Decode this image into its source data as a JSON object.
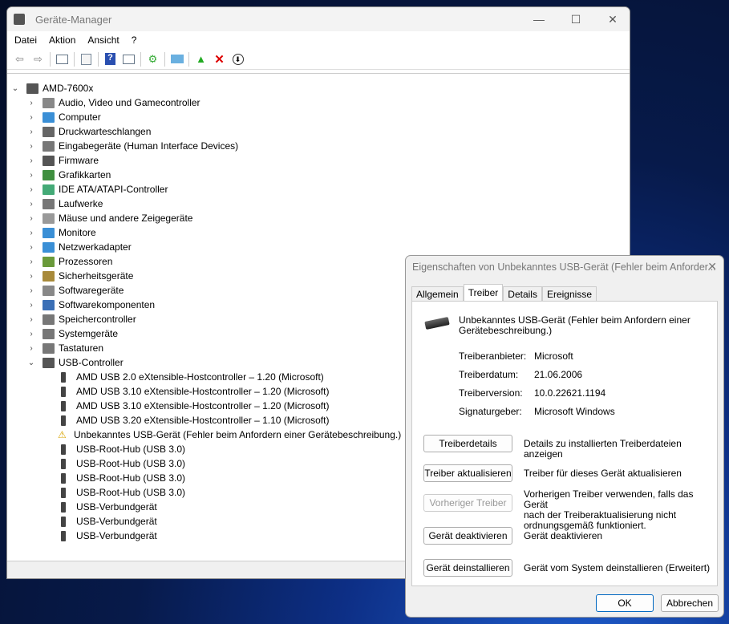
{
  "window": {
    "title": "Geräte-Manager",
    "minimize": "—",
    "maximize": "☐",
    "close": "✕"
  },
  "menu": [
    "Datei",
    "Aktion",
    "Ansicht",
    "?"
  ],
  "toolbar": [
    "back-icon",
    "forward-icon",
    "show-hide-tree-icon",
    "properties-icon",
    "help-icon",
    "action-pane-icon",
    "update-driver-icon",
    "scan-hardware-icon",
    "add-driver-icon",
    "uninstall-icon",
    "disable-icon"
  ],
  "tree": {
    "root": "AMD-7600x",
    "categories": [
      {
        "label": "Audio, Video und Gamecontroller",
        "color": "#888"
      },
      {
        "label": "Computer",
        "color": "#3a8fd6"
      },
      {
        "label": "Druckwarteschlangen",
        "color": "#666"
      },
      {
        "label": "Eingabegeräte (Human Interface Devices)",
        "color": "#777"
      },
      {
        "label": "Firmware",
        "color": "#555"
      },
      {
        "label": "Grafikkarten",
        "color": "#3f8f3f"
      },
      {
        "label": "IDE ATA/ATAPI-Controller",
        "color": "#4a7"
      },
      {
        "label": "Laufwerke",
        "color": "#777"
      },
      {
        "label": "Mäuse und andere Zeigegeräte",
        "color": "#999"
      },
      {
        "label": "Monitore",
        "color": "#3a8fd6"
      },
      {
        "label": "Netzwerkadapter",
        "color": "#3a8fd6"
      },
      {
        "label": "Prozessoren",
        "color": "#6a9a3a"
      },
      {
        "label": "Sicherheitsgeräte",
        "color": "#a88a3a"
      },
      {
        "label": "Softwaregeräte",
        "color": "#888"
      },
      {
        "label": "Softwarekomponenten",
        "color": "#3a6fb6"
      },
      {
        "label": "Speichercontroller",
        "color": "#777"
      },
      {
        "label": "Systemgeräte",
        "color": "#777"
      },
      {
        "label": "Tastaturen",
        "color": "#777"
      },
      {
        "label": "USB-Controller",
        "color": "#555",
        "expanded": true
      }
    ],
    "usb_children": [
      "AMD USB 2.0 eXtensible-Hostcontroller – 1.20 (Microsoft)",
      "AMD USB 3.10 eXtensible-Hostcontroller – 1.20 (Microsoft)",
      "AMD USB 3.10 eXtensible-Hostcontroller – 1.20 (Microsoft)",
      "AMD USB 3.20 eXtensible-Hostcontroller – 1.10 (Microsoft)",
      "Unbekanntes USB-Gerät (Fehler beim Anfordern einer Gerätebeschreibung.)",
      "USB-Root-Hub (USB 3.0)",
      "USB-Root-Hub (USB 3.0)",
      "USB-Root-Hub (USB 3.0)",
      "USB-Root-Hub (USB 3.0)",
      "USB-Verbundgerät",
      "USB-Verbundgerät",
      "USB-Verbundgerät"
    ],
    "warning_index": 4
  },
  "dialog": {
    "title": "Eigenschaften von Unbekanntes USB-Gerät (Fehler beim Anforder...",
    "close": "✕",
    "tabs": [
      "Allgemein",
      "Treiber",
      "Details",
      "Ereignisse"
    ],
    "active_tab": "Treiber",
    "device_name_1": "Unbekanntes USB-Gerät (Fehler beim Anfordern einer",
    "device_name_2": "Gerätebeschreibung.)",
    "fields": [
      {
        "label": "Treiberanbieter:",
        "value": "Microsoft"
      },
      {
        "label": "Treiberdatum:",
        "value": "21.06.2006"
      },
      {
        "label": "Treiberversion:",
        "value": "10.0.22621.1194"
      },
      {
        "label": "Signaturgeber:",
        "value": "Microsoft Windows"
      }
    ],
    "actions": [
      {
        "button": "Treiberdetails",
        "desc": [
          "Details zu installierten Treiberdateien anzeigen"
        ],
        "enabled": true
      },
      {
        "button": "Treiber aktualisieren",
        "desc": [
          "Treiber für dieses Gerät aktualisieren"
        ],
        "enabled": true
      },
      {
        "button": "Vorheriger Treiber",
        "desc": [
          "Vorherigen Treiber verwenden, falls das Gerät",
          "nach der Treiberaktualisierung nicht",
          "ordnungsgemäß funktioniert."
        ],
        "enabled": false
      },
      {
        "button": "Gerät deaktivieren",
        "desc": [
          "Gerät deaktivieren"
        ],
        "enabled": true
      },
      {
        "button": "Gerät deinstallieren",
        "desc": [
          "Gerät vom System deinstallieren (Erweitert)"
        ],
        "enabled": true
      }
    ],
    "ok": "OK",
    "cancel": "Abbrechen"
  }
}
